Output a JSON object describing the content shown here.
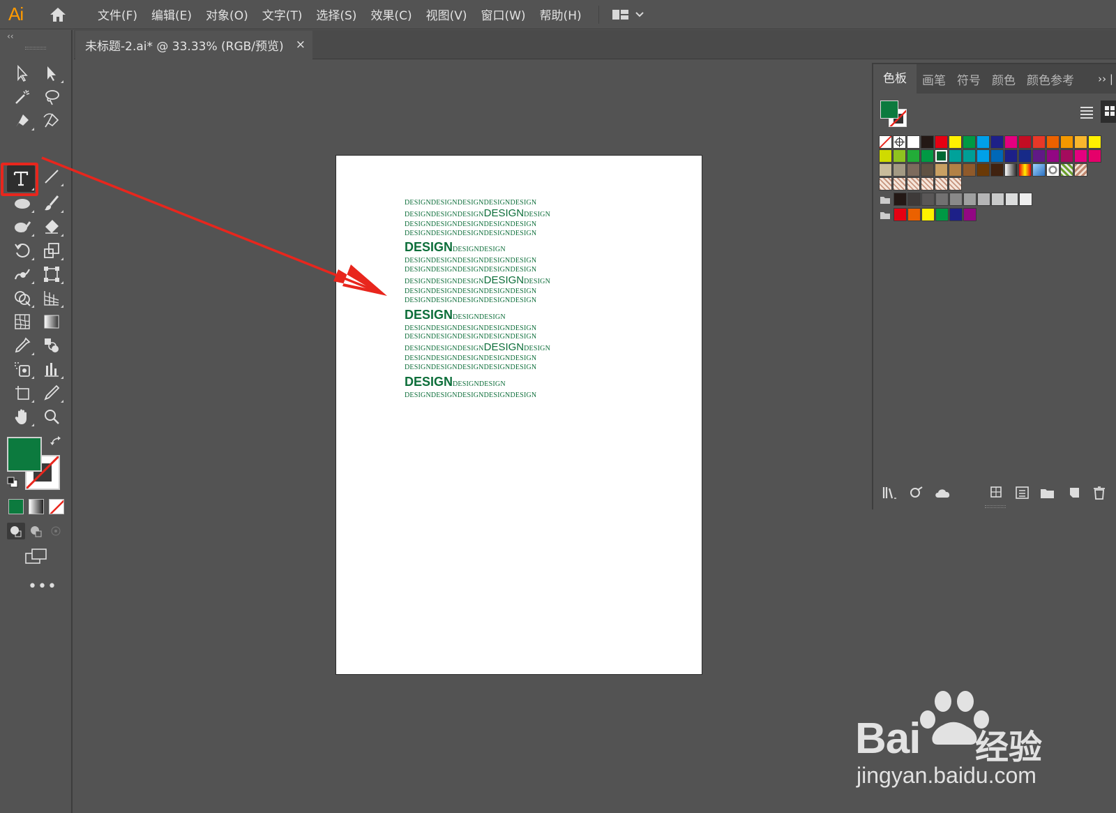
{
  "app": {
    "logo": "Ai"
  },
  "menu": [
    "文件(F)",
    "编辑(E)",
    "对象(O)",
    "文字(T)",
    "选择(S)",
    "效果(C)",
    "视图(V)",
    "窗口(W)",
    "帮助(H)"
  ],
  "document": {
    "tab_title": "未标题-2.ai* @ 33.33% (RGB/预览)",
    "close_label": "×"
  },
  "toolbar": {
    "collapse_label": "‹‹",
    "more_label": "•••"
  },
  "colors": {
    "fill": "#0c7a3e",
    "accent_red": "#e8261d",
    "text_green": "#0d6e3a"
  },
  "artboard": {
    "lines": [
      {
        "parts": [
          {
            "t": "DESIGNDESIGNDESIGNDESIGNDESIGN",
            "s": "small"
          }
        ]
      },
      {
        "parts": [
          {
            "t": "DESIGNDESIGNDESIGN",
            "s": "small"
          },
          {
            "t": "DESIGN",
            "s": "mid"
          },
          {
            "t": "DESIGN",
            "s": "small"
          }
        ]
      },
      {
        "parts": [
          {
            "t": "DESIGNDESIGNDESIGNDESIGNDESIGN",
            "s": "small"
          }
        ]
      },
      {
        "parts": [
          {
            "t": "DESIGNDESIGNDESIGNDESIGNDESIGN",
            "s": "small"
          }
        ]
      },
      {
        "parts": [
          {
            "t": "DESIGN",
            "s": "big"
          },
          {
            "t": "DESIGNDESIGN",
            "s": "small"
          }
        ]
      },
      {
        "parts": [
          {
            "t": "DESIGNDESIGNDESIGNDESIGNDESIGN",
            "s": "small"
          }
        ]
      },
      {
        "parts": [
          {
            "t": "DESIGNDESIGNDESIGNDESIGNDESIGN",
            "s": "small"
          }
        ]
      },
      {
        "parts": [
          {
            "t": "DESIGNDESIGNDESIGN",
            "s": "small"
          },
          {
            "t": "DESIGN",
            "s": "mid"
          },
          {
            "t": "DESIGN",
            "s": "small"
          }
        ]
      },
      {
        "parts": [
          {
            "t": "DESIGNDESIGNDESIGNDESIGNDESIGN",
            "s": "small"
          }
        ]
      },
      {
        "parts": [
          {
            "t": "DESIGNDESIGNDESIGNDESIGNDESIGN",
            "s": "small"
          }
        ]
      },
      {
        "parts": [
          {
            "t": "DESIGN",
            "s": "big"
          },
          {
            "t": "DESIGNDESIGN",
            "s": "small"
          }
        ]
      },
      {
        "parts": [
          {
            "t": "DESIGNDESIGNDESIGNDESIGNDESIGN",
            "s": "small"
          }
        ]
      },
      {
        "parts": [
          {
            "t": "DESIGNDESIGNDESIGNDESIGNDESIGN",
            "s": "small"
          }
        ]
      },
      {
        "parts": [
          {
            "t": "DESIGNDESIGNDESIGN",
            "s": "small"
          },
          {
            "t": "DESIGN",
            "s": "mid"
          },
          {
            "t": "DESIGN",
            "s": "small"
          }
        ]
      },
      {
        "parts": [
          {
            "t": "DESIGNDESIGNDESIGNDESIGNDESIGN",
            "s": "small"
          }
        ]
      },
      {
        "parts": [
          {
            "t": "DESIGNDESIGNDESIGNDESIGNDESIGN",
            "s": "small"
          }
        ]
      },
      {
        "parts": [
          {
            "t": "DESIGN",
            "s": "big"
          },
          {
            "t": "DESIGNDESIGN",
            "s": "small"
          }
        ]
      },
      {
        "parts": [
          {
            "t": "DESIGNDESIGNDESIGNDESIGNDESIGN",
            "s": "small"
          }
        ]
      }
    ]
  },
  "swatches_panel": {
    "tabs": [
      "色板",
      "画笔",
      "符号",
      "颜色",
      "颜色参考"
    ],
    "expand_label": "›› |",
    "rows": [
      [
        "none",
        "reg",
        "#ffffff",
        "#231815",
        "#e60012",
        "#fff100",
        "#009944",
        "#00a0e9",
        "#1d2088",
        "#e4007f",
        "#c30d23",
        "#e83828",
        "#eb6100",
        "#f39800",
        "#f8b62d",
        "#fff100"
      ],
      [
        "#cfdb00",
        "#8fc31f",
        "#22ac38",
        "#009944",
        "#006934",
        "#00a29a",
        "#009e96",
        "#00a0e9",
        "#0068b7",
        "#1d2088",
        "#172a88",
        "#601986",
        "#920783",
        "#a40b5d",
        "#e4007f",
        "#e5006a"
      ],
      [
        "#c9bc9c",
        "#a39a84",
        "#7d6b5d",
        "#5f5244",
        "#c9a063",
        "#b28146",
        "#8f5a2b",
        "#6a3906",
        "#40220f",
        "grad1",
        "grad2",
        "grad3",
        "pat1",
        "pat2",
        "pat3"
      ],
      [
        "pat4",
        "pat4",
        "pat4",
        "pat4",
        "pat4",
        "pat4"
      ],
      [
        "folder",
        "#231815",
        "#3e3a39",
        "#595757",
        "#727171",
        "#898989",
        "#9fa0a0",
        "#b5b5b6",
        "#c9caca",
        "#dcdddd",
        "#efefef"
      ],
      [
        "folder",
        "#e60012",
        "#eb6100",
        "#fff100",
        "#009944",
        "#1d2088",
        "#920783"
      ]
    ]
  },
  "watermark": {
    "brand": "Bai",
    "brand2": "经验",
    "url": "jingyan.baidu.com"
  }
}
